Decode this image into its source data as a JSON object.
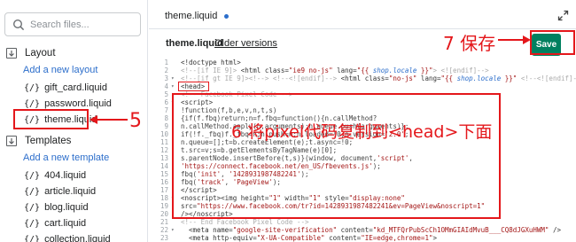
{
  "sidebar": {
    "search_placeholder": "Search files...",
    "layout_heading": "Layout",
    "add_layout": "Add a new layout",
    "layout_files": [
      "gift_card.liquid",
      "password.liquid",
      "theme.liquid"
    ],
    "templates_heading": "Templates",
    "add_template": "Add a new template",
    "template_files": [
      "404.liquid",
      "article.liquid",
      "blog.liquid",
      "cart.liquid",
      "collection.liquid"
    ]
  },
  "editor": {
    "tab_label": "theme.liquid",
    "file_title": "theme.liquid",
    "older_versions": "Older versions",
    "save_label": "Save",
    "line_numbers": [
      "1",
      "2",
      "3",
      "4",
      "5",
      "6",
      "7",
      "8",
      "9",
      "10",
      "11",
      "12",
      "13",
      "14",
      "15",
      "16",
      "17",
      "18",
      "19",
      "20",
      "21",
      "22",
      "23",
      "24"
    ]
  },
  "annotations": {
    "step5": "5",
    "step6": "6 将pixel代码复制到<head>下面",
    "step7": "7 保存"
  },
  "colors": {
    "annotation_red": "#e4171b",
    "save_green": "#008060",
    "link_blue": "#2c6ecb"
  }
}
